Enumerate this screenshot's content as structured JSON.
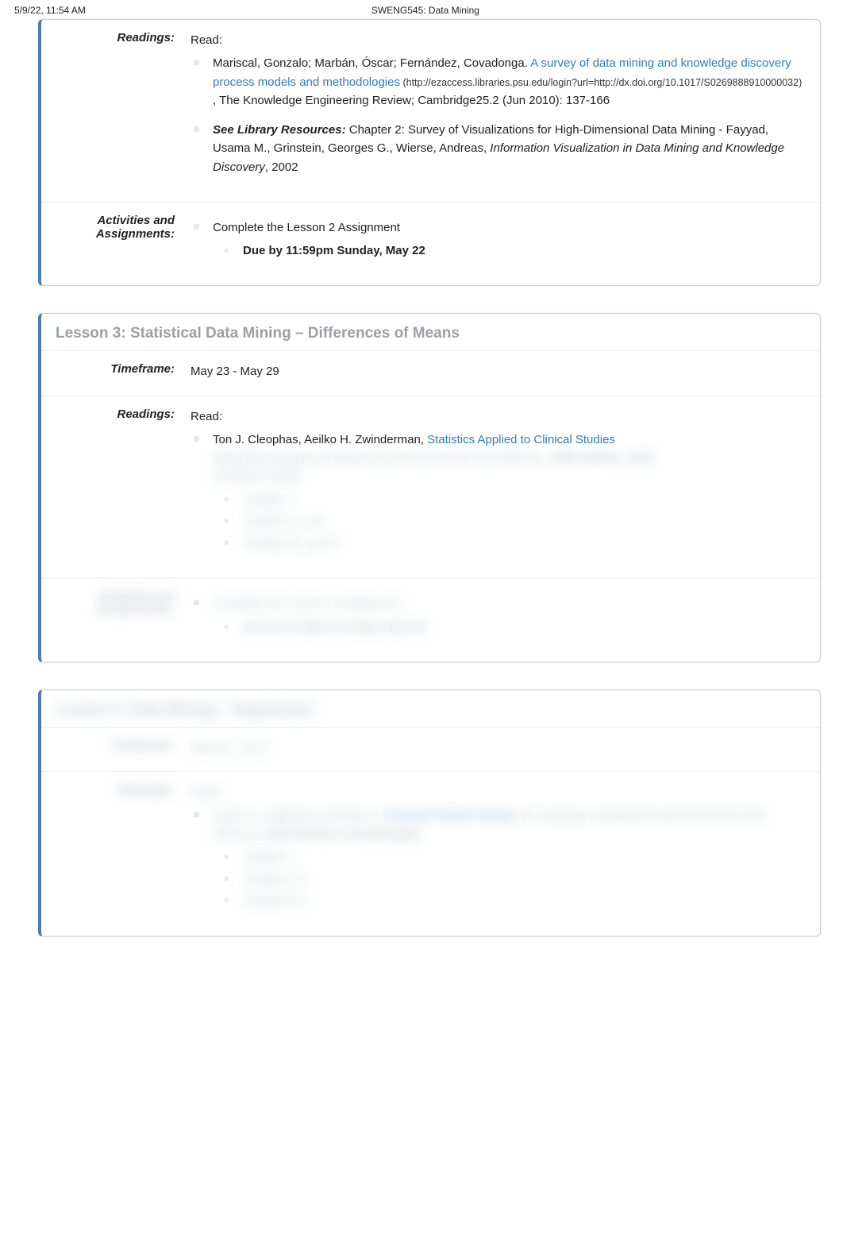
{
  "header": {
    "timestamp": "5/9/22, 11:54 AM",
    "title": "SWENG545: Data Mining"
  },
  "lesson2": {
    "readings_label": "Readings:",
    "read_label": "Read:",
    "item1_authors": "Mariscal, Gonzalo; Marbán, Óscar; Fernández, Covadonga. ",
    "item1_link": "A survey of data mining and knowledge discovery process models and methodologies",
    "item1_url": " (http://ezaccess.libraries.psu.edu/login?url=http://dx.doi.org/10.1017/S0269888910000032) ",
    "item1_tail": ", The Knowledge Engineering Review; Cambridge25.2 (Jun 2010): 137-166",
    "item2_prefix": "See Library Resources:",
    "item2_body": " Chapter 2: Survey of Visualizations for High-Dimensional Data Mining - Fayyad, Usama M., Grinstein, Georges G., Wierse, Andreas, ",
    "item2_italic": "Information Visualization in Data Mining and Knowledge Discovery",
    "item2_year": ", 2002",
    "act_label": "Activities and Assignments:",
    "act_item": "Complete the Lesson 2 Assignment",
    "act_due": "Due by 11:59pm Sunday, May 22"
  },
  "lesson3": {
    "title": "Lesson 3: Statistical Data Mining – Differences of Means",
    "timeframe_label": "Timeframe:",
    "timeframe_value": "May 23 - May 29",
    "readings_label": "Readings:",
    "read_label": "Read:",
    "item1_authors": "Ton J. Cleophas, Aeilko H. Zwinderman, ",
    "item1_link": "Statistics Applied to Clinical Studies",
    "item1_hidden_url": "(http://link.springer.com/book/10.1007%2F978-94-007-2863-9)",
    "item1_hidden_pub": ", Fifth Edition, 2012",
    "item1_hidden_note": "Dordrecht Online",
    "chapters": [
      "Chapter 1",
      "Chapter 2, p.31",
      "Chapter 25, p.279"
    ],
    "act_label": "Activities and Assignments:",
    "act_item": "Complete the Lesson 3 Assignment",
    "act_due": "Due by 11:59pm Sunday, May 29"
  },
  "lesson4": {
    "title": "Lesson 4: Data Mining – Regression",
    "timeframe_label": "Timeframe:",
    "timeframe_value": "May 30 - Jun 5",
    "readings_label": "Readings:",
    "read_label": "Read:",
    "item1_authors": "Charu C. Aggarwal, Chandan K. ",
    "item1_link": "Frequent Pattern Mining",
    "item1_tail": ", doi: springer.com/book/10.1007%2F978-3-319-07821-2)",
    "item1_pub": ", 2014 (Online e-book/Apple)",
    "chapters": [
      "Chapter 1",
      "Chapter 2-4",
      "Chapter 5-9"
    ]
  }
}
